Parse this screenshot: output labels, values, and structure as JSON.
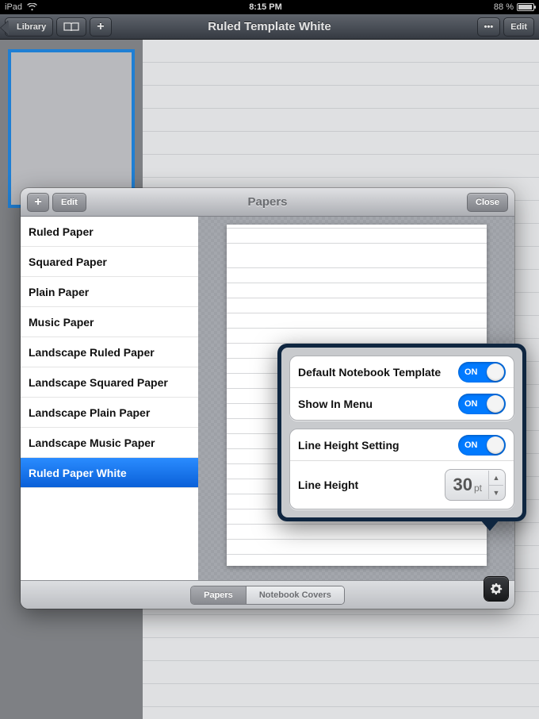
{
  "status": {
    "device": "iPad",
    "time": "8:15 PM",
    "battery_pct": "88 %"
  },
  "nav": {
    "back_label": "Library",
    "more_label": "•••",
    "edit_label": "Edit",
    "plus_label": "+",
    "title": "Ruled Template White"
  },
  "papers_modal": {
    "title": "Papers",
    "add_label": "+",
    "edit_label": "Edit",
    "close_label": "Close",
    "list": [
      {
        "label": "Ruled Paper",
        "selected": false
      },
      {
        "label": "Squared Paper",
        "selected": false
      },
      {
        "label": "Plain Paper",
        "selected": false
      },
      {
        "label": "Music Paper",
        "selected": false
      },
      {
        "label": "Landscape Ruled Paper",
        "selected": false
      },
      {
        "label": "Landscape Squared Paper",
        "selected": false
      },
      {
        "label": "Landscape Plain Paper",
        "selected": false
      },
      {
        "label": "Landscape Music Paper",
        "selected": false
      },
      {
        "label": "Ruled Paper White",
        "selected": true
      }
    ],
    "segments": {
      "papers": "Papers",
      "covers": "Notebook Covers"
    }
  },
  "popover": {
    "default_template_label": "Default Notebook Template",
    "show_in_menu_label": "Show In Menu",
    "line_height_setting_label": "Line Height Setting",
    "line_height_label": "Line Height",
    "toggle_on": "ON",
    "line_height_value": "30",
    "line_height_unit": "pt"
  }
}
